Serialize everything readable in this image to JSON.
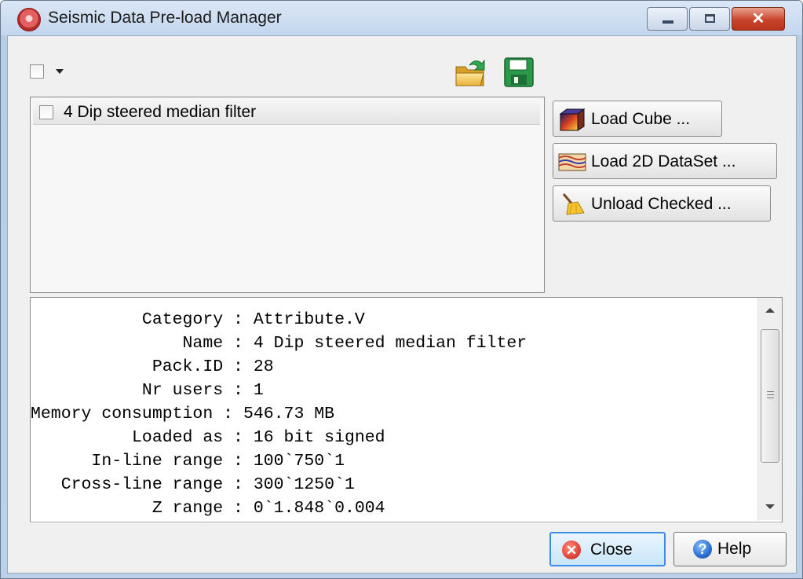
{
  "window": {
    "title": "Seismic Data Pre-load Manager",
    "app_icon": "seismic-app-icon",
    "controls": [
      "minimize",
      "maximize",
      "close"
    ]
  },
  "toolbar": {
    "select_all_checked": false,
    "icons": [
      "open-folder-icon",
      "save-disk-icon"
    ]
  },
  "loaded_list": {
    "items": [
      {
        "label": "4 Dip steered median filter",
        "checked": false
      }
    ]
  },
  "actions": {
    "load_cube": "Load Cube ...",
    "load_2d": "Load 2D DataSet ...",
    "unload_checked": "Unload Checked ..."
  },
  "info": {
    "lines": [
      "           Category : Attribute.V",
      "               Name : 4 Dip steered median filter",
      "            Pack.ID : 28",
      "           Nr users : 1",
      "Memory consumption : 546.73 MB",
      "          Loaded as : 16 bit signed",
      "      In-line range : 100`750`1",
      "   Cross-line range : 300`1250`1",
      "            Z range : 0`1.848`0.004"
    ]
  },
  "footer": {
    "close": "Close",
    "help": "Help"
  },
  "colors": {
    "title_bar": "#c9daf0",
    "close_button_red": "#c9442b",
    "close_focus_blue": "#3d8ee0",
    "help_icon_blue": "#2a6ed0",
    "close_icon_red": "#e0473a"
  }
}
